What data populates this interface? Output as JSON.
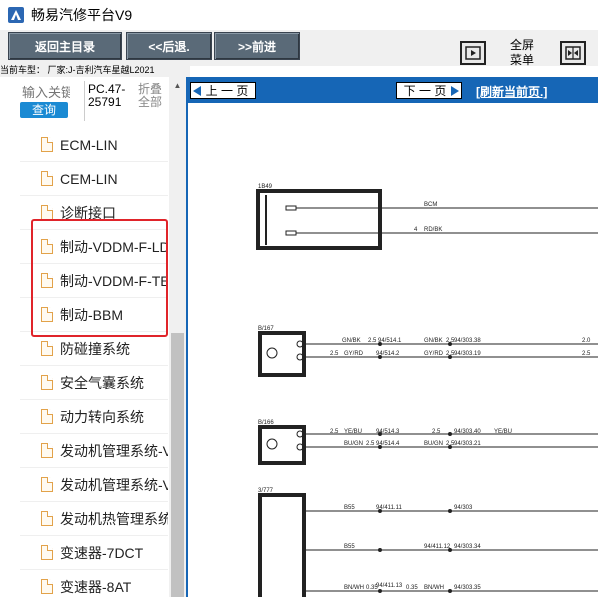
{
  "window": {
    "title": "畅易汽修平台V9"
  },
  "toolbar": {
    "home_label": "返回主目录",
    "back_label": "<<后退.",
    "forward_label": ">>前进",
    "fullscreen_label": "全屏",
    "menu_label": "菜单"
  },
  "car_info": "当前车型： 厂家:J-吉利汽车星越L2021",
  "left": {
    "search_placeholder": "输入关键",
    "search_button": "查询",
    "pc_code": "PC.47-25791",
    "fold_all": "折叠全部",
    "tree_items": [
      "ECM-LIN",
      "CEM-LIN",
      "诊断接口",
      "制动-VDDM-F-LDC",
      "制动-VDDM-F-TEC",
      "制动-BBM",
      "防碰撞系统",
      "安全气囊系统",
      "动力转向系统",
      "发动机管理系统-VEP",
      "发动机管理系统-VEP",
      "发动机热管理系统",
      "变速器-7DCT",
      "变速器-8AT"
    ]
  },
  "nav": {
    "prev_label": "上 一 页",
    "next_label": "下 一 页",
    "refresh_label": "[刷新当前页.]"
  },
  "diagram": {
    "labels": {
      "conn1": "1B49",
      "bcm": "BCM",
      "pin4": "4",
      "rdbk": "RD/BK",
      "conn2": "B/167",
      "gnbk": "GN/BK",
      "w25a": "2.5",
      "s1": "94/514.1",
      "gnbk2": "GN/BK",
      "w25b": "2.5",
      "s2": "94/303.38",
      "w20": "2.0",
      "gyrd": "GY/RD",
      "w25c": "2.5",
      "s3": "94/514.2",
      "gyrd2": "GY/RD",
      "w25d": "2.5",
      "s4": "94/303.19",
      "w25e": "2.5",
      "conn3": "B/166",
      "w25f": "2.5",
      "yebu": "YE/BU",
      "s5": "94/514.3",
      "w25g": "2.5",
      "s6": "94/303.40",
      "yebu2": "YE/BU",
      "bugn": "BU/GN",
      "w25h": "2.5",
      "s7": "94/514.4",
      "bugn2": "BU/GN",
      "w25i": "2.5",
      "s8": "94/303.21",
      "conn4": "3/777",
      "b55": "B55",
      "s9": "94/411.11",
      "s10": "94/303",
      "b55b": "B55",
      "s11": "94/411.12",
      "s12": "94/303.34",
      "bnwh": "BN/WH",
      "w035a": "0.35",
      "s13": "94/411.13",
      "w035b": "0.35",
      "bnwh2": "BN/WH",
      "s14": "94/303.35"
    }
  }
}
